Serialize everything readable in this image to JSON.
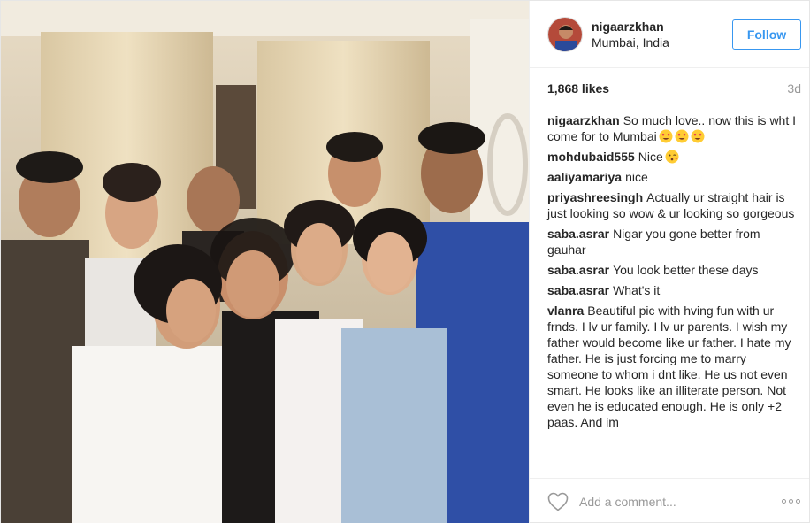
{
  "post": {
    "username": "nigaarzkhan",
    "location": "Mumbai, India",
    "follow_label": "Follow",
    "likes": "1,868 likes",
    "age": "3d",
    "add_comment_placeholder": "Add a comment..."
  },
  "comments": [
    {
      "user": "nigaarzkhan",
      "text": "So much love.. now this is wht I come for to Mumbai",
      "emojis": [
        "heart-eyes-emoji",
        "heart-eyes-emoji",
        "heart-eyes-emoji"
      ]
    },
    {
      "user": "mohdubaid555",
      "text": "Nice",
      "emojis": [
        "kissing-face-emoji"
      ]
    },
    {
      "user": "aaliyamariya",
      "text": "nice",
      "emojis": []
    },
    {
      "user": "priyashreesingh",
      "text": "Actually ur straight hair is just looking so wow & ur looking so gorgeous",
      "emojis": []
    },
    {
      "user": "saba.asrar",
      "text": "Nigar you gone better from gauhar",
      "emojis": []
    },
    {
      "user": "saba.asrar",
      "text": "You look better these days",
      "emojis": []
    },
    {
      "user": "saba.asrar",
      "text": "What's it",
      "emojis": []
    },
    {
      "user": "vlanra",
      "text": "Beautiful pic with hving fun with ur frnds. I lv ur family. I lv ur parents. I wish my father would become like ur father. I hate my father. He is just forcing me to marry someone to whom i dnt like. He us not even smart. He looks like an illiterate person. Not even he is educated enough. He is only +2 paas. And im",
      "emojis": []
    }
  ],
  "icons": {
    "like": "heart-outline-icon",
    "options": "more-options-icon"
  },
  "colors": {
    "accent": "#3897f0",
    "muted": "#999999",
    "text": "#262626"
  }
}
